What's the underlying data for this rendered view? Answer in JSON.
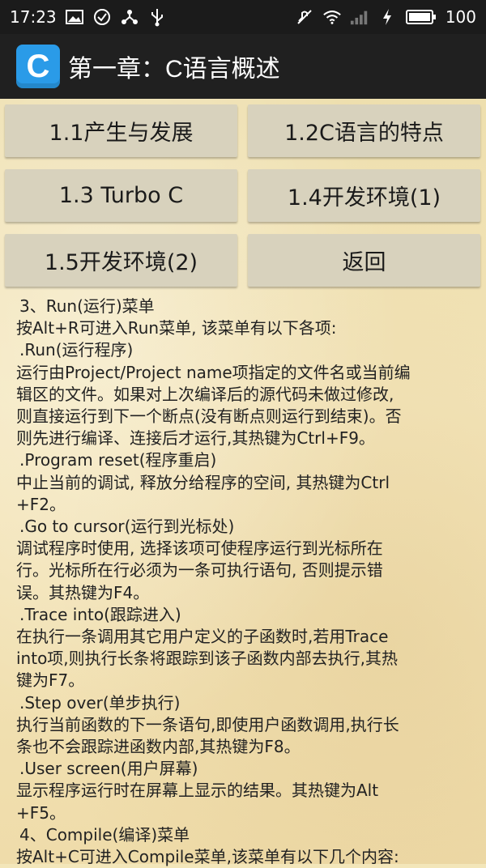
{
  "status_bar": {
    "time": "17:23",
    "battery": "100",
    "icons_left": [
      "image-icon",
      "check-circle-icon",
      "share-icon",
      "usb-icon"
    ],
    "icons_right": [
      "mute-icon",
      "wifi-icon",
      "signal-icon",
      "charging-icon",
      "battery-icon"
    ]
  },
  "app_bar": {
    "logo_letter": "C",
    "title": "第一章：C语言概述"
  },
  "nav_buttons": [
    "1.1产生与发展",
    "1.2C语言的特点",
    "1.3 Turbo C",
    "1.4开发环境(1)",
    "1.5开发环境(2)",
    "返回"
  ],
  "article_lines": [
    " 3、Run(运行)菜单",
    "按Alt+R可进入Run菜单, 该菜单有以下各项:",
    " .Run(运行程序)",
    "运行由Project/Project name项指定的文件名或当前编",
    "辑区的文件。如果对上次编译后的源代码未做过修改,",
    "则直接运行到下一个断点(没有断点则运行到结束)。否",
    "则先进行编译、连接后才运行,其热键为Ctrl+F9。",
    " .Program reset(程序重启)",
    "中止当前的调试, 释放分给程序的空间, 其热键为Ctrl",
    "+F2。",
    " .Go to cursor(运行到光标处)",
    "调试程序时使用, 选择该项可使程序运行到光标所在",
    "行。光标所在行必须为一条可执行语句, 否则提示错",
    "误。其热键为F4。",
    " .Trace into(跟踪进入)",
    "在执行一条调用其它用户定义的子函数时,若用Trace",
    "into项,则执行长条将跟踪到该子函数内部去执行,其热",
    "键为F7。",
    " .Step over(单步执行)",
    "执行当前函数的下一条语句,即使用户函数调用,执行长",
    "条也不会跟踪进函数内部,其热键为F8。",
    " .User screen(用户屏幕)",
    "显示程序运行时在屏幕上显示的结果。其热键为Alt",
    "+F5。",
    " 4、Compile(编译)菜单",
    "按Alt+C可进入Compile菜单,该菜单有以下几个内容:"
  ]
}
